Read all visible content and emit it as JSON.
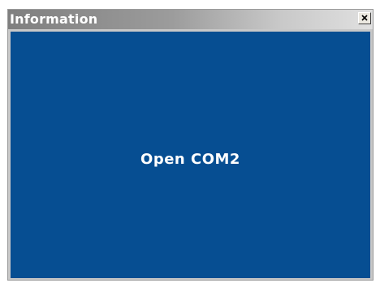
{
  "window": {
    "title": "Information",
    "close_glyph": "close-icon"
  },
  "content": {
    "message": "Open COM2"
  },
  "colors": {
    "content_background": "#064e92",
    "message_text": "#ffffff",
    "title_text": "#ffffff"
  }
}
